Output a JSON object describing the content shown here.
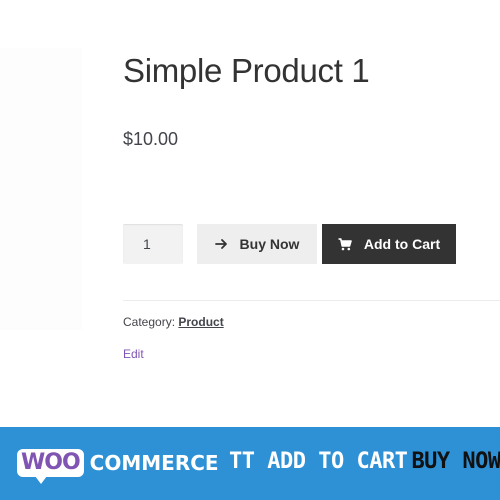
{
  "product": {
    "title": "Simple Product 1",
    "price": "$10.00",
    "quantity": "1",
    "buy_now_label": "Buy Now",
    "add_to_cart_label": "Add to Cart",
    "category_label": "Category:",
    "category_value": "Product",
    "edit_label": "Edit"
  },
  "banner": {
    "logo_woo": "WOO",
    "logo_commerce": "COMMERCE",
    "text_main": "TT ADD TO CART",
    "text_accent": "BUY NOW"
  },
  "icons": {
    "buy_now": "arrow-right-icon",
    "add_to_cart": "cart-icon"
  },
  "colors": {
    "banner_bg": "#2e91d6",
    "woo_purple": "#7f54b3",
    "add_to_cart_bg": "#333333",
    "buy_now_bg": "#eeeeee"
  }
}
